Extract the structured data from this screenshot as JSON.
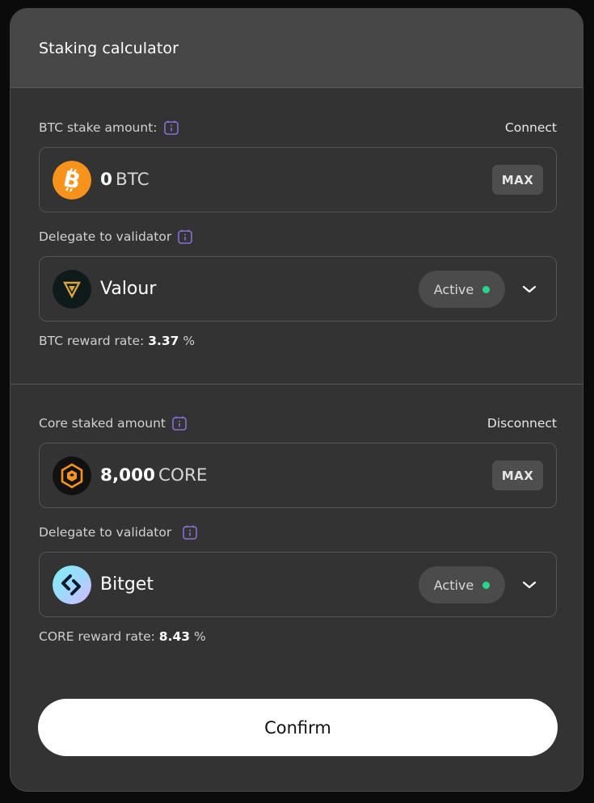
{
  "header": {
    "title": "Staking calculator"
  },
  "btc": {
    "label": "BTC stake amount:",
    "wallet_action": "Connect",
    "amount_value": "0",
    "amount_unit": "BTC",
    "max_label": "MAX",
    "validator_label": "Delegate to validator",
    "validator_name": "Valour",
    "validator_status": "Active",
    "reward_label": "BTC reward rate:",
    "reward_value": "3.37",
    "reward_unit": "%"
  },
  "core": {
    "label": "Core staked amount",
    "wallet_action": "Disconnect",
    "amount_value": "8,000",
    "amount_unit": "CORE",
    "max_label": "MAX",
    "validator_label": "Delegate to validator",
    "validator_name": "Bitget",
    "validator_status": "Active",
    "reward_label": "CORE reward rate:",
    "reward_value": "8.43",
    "reward_unit": "%"
  },
  "confirm_label": "Confirm",
  "colors": {
    "status_active": "#28d58b",
    "info_icon": "#8b6fd6",
    "btc_orange": "#f7931a",
    "core_orange": "#f7931a"
  },
  "icons": [
    "info-icon",
    "bitcoin-icon",
    "core-icon",
    "valour-icon",
    "bitget-icon",
    "chevron-down-icon"
  ]
}
